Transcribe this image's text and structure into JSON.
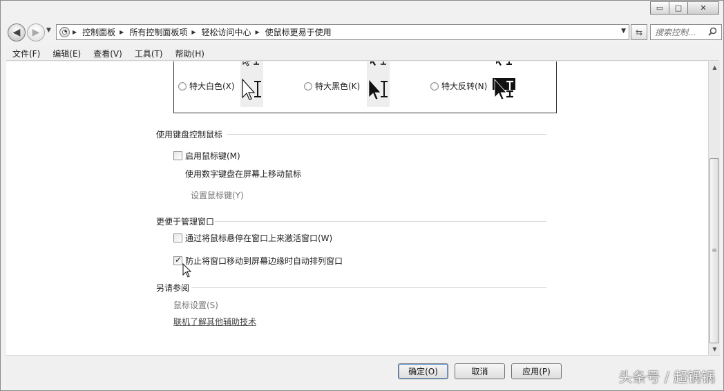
{
  "window": {
    "caption_minimize": "▭",
    "caption_maximize": "□",
    "caption_close": "✕"
  },
  "navigation": {
    "breadcrumbs": [
      "控制面板",
      "所有控制面板项",
      "轻松访问中心",
      "使鼠标更易于使用"
    ],
    "search_placeholder": "搜索控制..."
  },
  "menubar": {
    "items": [
      "文件(F)",
      "编辑(E)",
      "查看(V)",
      "工具(T)",
      "帮助(H)"
    ]
  },
  "pointer_schemes": [
    {
      "label": "特大白色(X)",
      "style": "white",
      "selected": false
    },
    {
      "label": "特大黑色(K)",
      "style": "black",
      "selected": false
    },
    {
      "label": "特大反转(N)",
      "style": "inverted",
      "selected": false
    }
  ],
  "keyboard_section": {
    "heading": "使用键盘控制鼠标",
    "enable_mouse_keys": {
      "label": "启用鼠标键(M)",
      "checked": false
    },
    "description": "使用数字键盘在屏幕上移动鼠标",
    "setup_link": "设置鼠标键(Y)"
  },
  "window_section": {
    "heading": "更便于管理窗口",
    "hover_activate": {
      "label": "通过将鼠标悬停在窗口上来激活窗口(W)",
      "checked": false
    },
    "prevent_snap": {
      "label": "防止将窗口移动到屏幕边缘时自动排列窗口",
      "checked": true
    }
  },
  "see_also": {
    "heading": "另请参阅",
    "mouse_settings": "鼠标设置(S)",
    "online_link": "联机了解其他辅助技术"
  },
  "buttons": {
    "ok": "确定(O)",
    "cancel": "取消",
    "apply": "应用(P)"
  },
  "watermark": "头条号 / 超锅锅",
  "colors": {
    "window_bg": "#f1f1f1",
    "content_bg": "#ffffff",
    "disabled_text": "#777777"
  }
}
